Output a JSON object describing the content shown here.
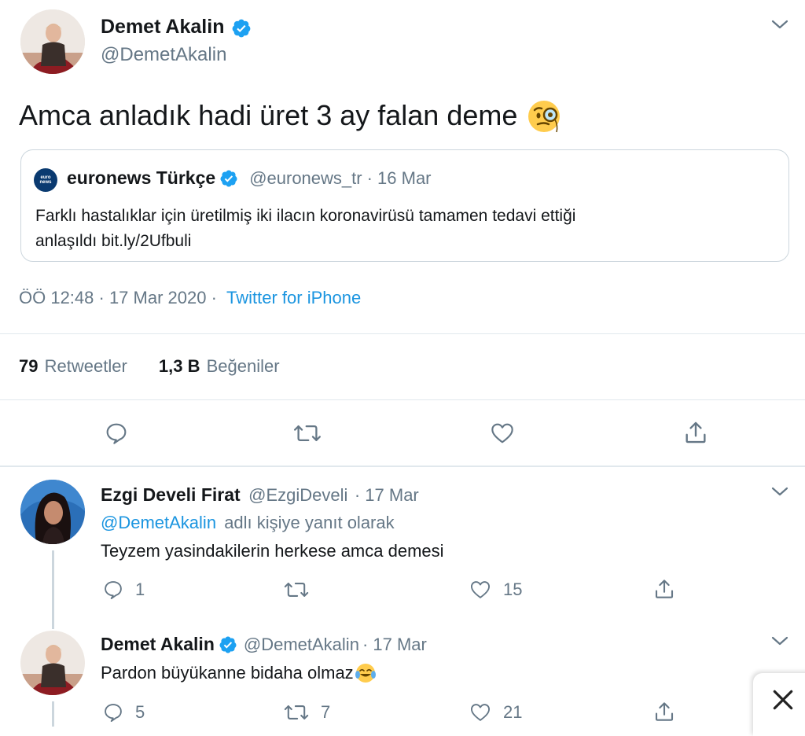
{
  "main_tweet": {
    "author_name": "Demet Akalin",
    "author_handle": "@DemetAkalin",
    "text": "Amca anladık hadi üret 3 ay falan deme",
    "quoted": {
      "name": "euronews Türkçe",
      "handle": "@euronews_tr",
      "date": "· 16 Mar",
      "text_line1": "Farklı hastalıklar için üretilmiş iki ilacın koronavirüsü tamamen tedavi ettiği",
      "text_line2": "anlaşıldı bit.ly/2Ufbuli",
      "logo_text": "euro news"
    },
    "timestamp": "ÖÖ 12:48 · 17 Mar 2020 ·",
    "source": "Twitter for iPhone",
    "retweets_count": "79",
    "retweets_label": "Retweetler",
    "likes_count": "1,3 B",
    "likes_label": "Beğeniler"
  },
  "replies": [
    {
      "author_name": "Ezgi Develi Firat",
      "author_handle": "@EzgiDeveli",
      "date": "· 17 Mar",
      "reply_to_handle": "@DemetAkalin",
      "reply_to_suffix": "adlı kişiye yanıt olarak",
      "text": "Teyzem yasindakilerin herkese amca demesi",
      "reply_count": "1",
      "retweet_count": "",
      "like_count": "15"
    },
    {
      "author_name": "Demet Akalin",
      "author_handle": "@DemetAkalin",
      "date": "· 17 Mar",
      "text": "Pardon büyükanne bidaha olmaz",
      "reply_count": "5",
      "retweet_count": "7",
      "like_count": "21"
    }
  ],
  "icons": {
    "verified": "verified-badge-icon",
    "reply": "reply-icon",
    "retweet": "retweet-icon",
    "like": "heart-icon",
    "share": "share-icon",
    "more": "chevron-down-icon",
    "close": "close-icon"
  },
  "colors": {
    "accent": "#1b95e0",
    "muted": "#657786",
    "border": "#e1e8ed"
  }
}
